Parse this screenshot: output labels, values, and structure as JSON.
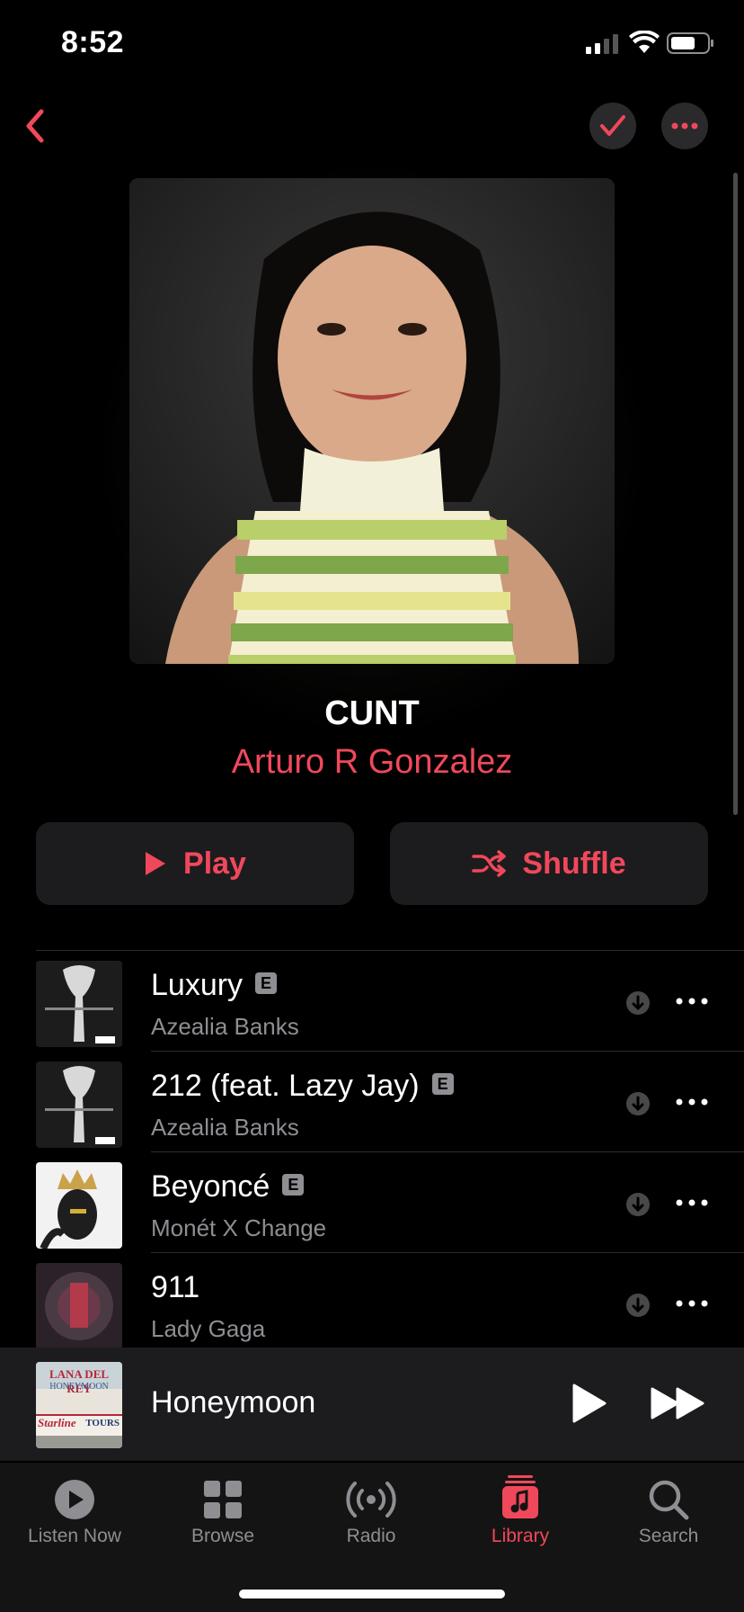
{
  "status_bar": {
    "time": "8:52"
  },
  "album": {
    "title": "CUNT",
    "artist": "Arturo R Gonzalez"
  },
  "actions": {
    "play_label": "Play",
    "shuffle_label": "Shuffle"
  },
  "tracks": [
    {
      "title": "Luxury",
      "artist": "Azealia Banks",
      "explicit": "E"
    },
    {
      "title": "212 (feat. Lazy Jay)",
      "artist": "Azealia Banks",
      "explicit": "E"
    },
    {
      "title": "Beyoncé",
      "artist": "Monét X Change",
      "explicit": "E"
    },
    {
      "title": "911",
      "artist": "Lady Gaga",
      "explicit": ""
    }
  ],
  "mini_player": {
    "title": "Honeymoon",
    "art_text_top": "LANA DEL REY",
    "art_text_mid": "HONEYMOON",
    "art_text_left": "Starline",
    "art_text_right": "TOURS"
  },
  "tabbar": {
    "tabs": [
      {
        "label": "Listen Now",
        "icon": "play-circle-icon"
      },
      {
        "label": "Browse",
        "icon": "grid-icon"
      },
      {
        "label": "Radio",
        "icon": "radio-waves-icon"
      },
      {
        "label": "Library",
        "icon": "music-note-icon",
        "active": true
      },
      {
        "label": "Search",
        "icon": "search-icon"
      }
    ]
  },
  "colors": {
    "accent": "#f0485b",
    "secondary_text": "#8e8e93",
    "card": "#1c1c1e"
  }
}
